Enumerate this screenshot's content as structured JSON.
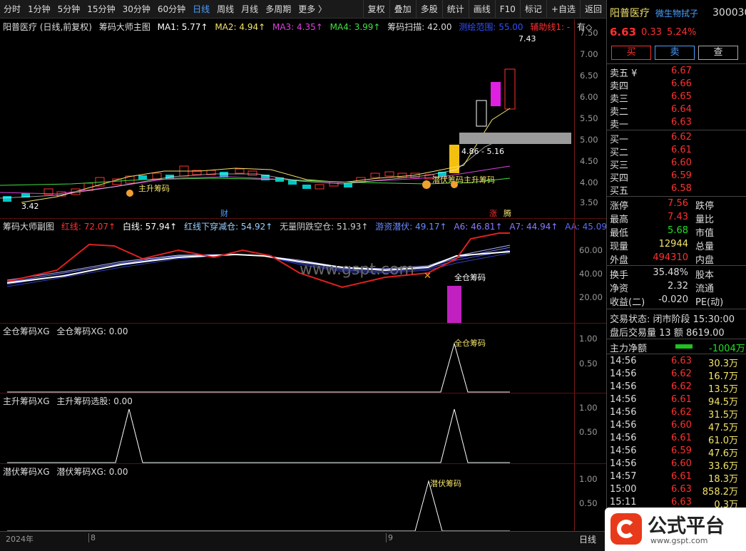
{
  "toolbar": {
    "periods": [
      "分时",
      "1分钟",
      "5分钟",
      "15分钟",
      "30分钟",
      "60分钟",
      "日线",
      "周线",
      "月线",
      "多周期",
      "更多 〉"
    ],
    "active": "日线",
    "right_buttons": [
      "复权",
      "叠加",
      "多股",
      "统计",
      "画线",
      "F10",
      "标记",
      "+自选",
      "返回"
    ]
  },
  "main": {
    "title": "阳普医疗 (日线,前复权)",
    "indicator": "筹码大师主图",
    "ma1": "MA1: 5.77↑",
    "ma2": "MA2: 4.94↑",
    "ma3": "MA3: 4.35↑",
    "ma4": "MA4: 3.99↑",
    "scan": "筹码扫描: 42.00",
    "range": "测绘范围: 55.00",
    "aux": "辅助线1: -",
    "aux2": "有◇",
    "high_label": "7.43",
    "low_label": "3.42",
    "range_label": "4.86 - 5.16",
    "signal1": "主升筹码",
    "signal2": "潜伏筹码主升筹码",
    "tag_cai": "财",
    "tag_zhang": "涨",
    "tag_teng": "腾",
    "yticks": [
      "7.50",
      "7.00",
      "6.50",
      "6.00",
      "5.50",
      "5.00",
      "4.50",
      "4.00",
      "3.50"
    ]
  },
  "sub1": {
    "name": "筹码大师副图",
    "red": "红线: 72.07↑",
    "white": "白线: 57.94↑",
    "v3": "红线下穿减仓: 54.92↑",
    "v4": "无量阴跌空仓: 51.93↑",
    "v5": "游资潜伏: 49.17↑",
    "v6": "A6: 46.81↑",
    "v7": "A7: 44.94↑",
    "v8": "AA: 45.09↑",
    "label": "全仓筹码",
    "watermark": "www.gspt.com",
    "yticks": [
      "60.00",
      "40.00",
      "20.00"
    ]
  },
  "sub2": {
    "name": "全仓筹码XG",
    "value": "全仓筹码XG: 0.00",
    "label": "全仓筹码",
    "yticks": [
      "1.00",
      "0.50"
    ]
  },
  "sub3": {
    "name": "主升筹码XG",
    "value": "主升筹码选股: 0.00",
    "yticks": [
      "1.00",
      "0.50"
    ]
  },
  "sub4": {
    "name": "潜伏筹码XG",
    "value": "潜伏筹码XG: 0.00",
    "label": "潜伏筹码",
    "yticks": [
      "1.00",
      "0.50"
    ]
  },
  "xaxis": {
    "year": "2024年",
    "m8": "8",
    "m9": "9"
  },
  "bottom_right": "日线",
  "side": {
    "name": "阳普医疗",
    "sector": "微生物拭子",
    "code": "300030",
    "price": "6.63",
    "change": "0.33",
    "pct": "5.24%",
    "buy_btn": "买",
    "sell_btn": "卖",
    "query_btn": "查",
    "asks": [
      [
        "卖五 ¥",
        "6.67"
      ],
      [
        "卖四",
        "6.66"
      ],
      [
        "卖三",
        "6.65"
      ],
      [
        "卖二",
        "6.64"
      ],
      [
        "卖一",
        "6.63"
      ]
    ],
    "bids": [
      [
        "买一",
        "6.62"
      ],
      [
        "买二",
        "6.61"
      ],
      [
        "买三",
        "6.60"
      ],
      [
        "买四",
        "6.59"
      ],
      [
        "买五",
        "6.58"
      ]
    ],
    "stats": [
      [
        "涨停",
        "7.56",
        "跌停"
      ],
      [
        "最高",
        "7.43",
        "量比"
      ],
      [
        "最低",
        "5.68",
        "市值"
      ],
      [
        "现量",
        "12944",
        "总量"
      ],
      [
        "外盘",
        "494310",
        "内盘"
      ]
    ],
    "stats2": [
      [
        "换手",
        "35.48%",
        "股本"
      ],
      [
        "净资",
        "2.32",
        "流通"
      ],
      [
        "收益(二)",
        "-0.020",
        "PE(动)"
      ]
    ],
    "trade_state": "交易状态: 闭市阶段 15:30:00",
    "after_hours": "盘后交易量 13 额 8619.00",
    "net_flow_label": "主力净额",
    "net_flow_value": "-1004万",
    "ticks": [
      [
        "14:56",
        "6.63",
        "30.3万"
      ],
      [
        "14:56",
        "6.62",
        "16.7万"
      ],
      [
        "14:56",
        "6.62",
        "13.5万"
      ],
      [
        "14:56",
        "6.61",
        "94.5万"
      ],
      [
        "14:56",
        "6.62",
        "31.5万"
      ],
      [
        "14:56",
        "6.60",
        "47.5万"
      ],
      [
        "14:56",
        "6.61",
        "61.0万"
      ],
      [
        "14:56",
        "6.59",
        "47.6万"
      ],
      [
        "14:56",
        "6.60",
        "33.6万"
      ],
      [
        "14:57",
        "6.61",
        "18.3万"
      ],
      [
        "15:00",
        "6.63",
        "858.2万"
      ],
      [
        "15:11",
        "6.63",
        "0.3万"
      ]
    ]
  },
  "brand": {
    "name": "公式平台",
    "url": "www.gspt.com"
  }
}
